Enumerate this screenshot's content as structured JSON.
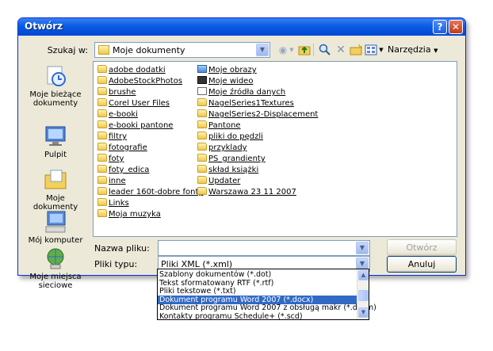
{
  "window": {
    "title": "Otwórz",
    "help_label": "?",
    "close_label": "✕"
  },
  "lookin": {
    "label": "Szukaj w:",
    "value": "Moje dokumenty"
  },
  "toolbar": {
    "tools_label": "Narzędzia"
  },
  "places": [
    {
      "label": "Moje bieżące dokumenty",
      "icon": "recent-documents-icon"
    },
    {
      "label": "Pulpit",
      "icon": "desktop-icon"
    },
    {
      "label": "Moje dokumenty",
      "icon": "my-documents-icon"
    },
    {
      "label": "Mój komputer",
      "icon": "my-computer-icon"
    },
    {
      "label": "Moje miejsca sieciowe",
      "icon": "network-places-icon"
    }
  ],
  "files_col1": [
    {
      "name": "adobe dodatki",
      "type": "folder"
    },
    {
      "name": "AdobeStockPhotos",
      "type": "folder"
    },
    {
      "name": "brushe",
      "type": "folder"
    },
    {
      "name": "Corel User Files",
      "type": "folder"
    },
    {
      "name": "e-booki",
      "type": "folder"
    },
    {
      "name": "e-booki pantone",
      "type": "folder"
    },
    {
      "name": "filtry",
      "type": "folder"
    },
    {
      "name": "fotografie",
      "type": "folder"
    },
    {
      "name": "foty",
      "type": "folder"
    },
    {
      "name": "foty_edica",
      "type": "folder"
    },
    {
      "name": "inne",
      "type": "folder"
    },
    {
      "name": "leader 160t-dobre fonty",
      "type": "folder"
    },
    {
      "name": "Links",
      "type": "folder"
    },
    {
      "name": "Moja muzyka",
      "type": "folder"
    }
  ],
  "files_col2": [
    {
      "name": "Moje obrazy",
      "type": "img"
    },
    {
      "name": "Moje wideo",
      "type": "vid"
    },
    {
      "name": "Moje źródła danych",
      "type": "data"
    },
    {
      "name": "NagelSeries1Textures",
      "type": "folder"
    },
    {
      "name": "NagelSeries2-Displacement",
      "type": "folder"
    },
    {
      "name": "Pantone",
      "type": "folder"
    },
    {
      "name": "pliki do pędzli",
      "type": "folder"
    },
    {
      "name": "przyklady",
      "type": "folder"
    },
    {
      "name": "PS_grandienty",
      "type": "folder"
    },
    {
      "name": "skład książki",
      "type": "folder"
    },
    {
      "name": "Updater",
      "type": "folder"
    },
    {
      "name": "Warszawa 23 11 2007",
      "type": "folder"
    }
  ],
  "filename": {
    "label": "Nazwa pliku:",
    "value": ""
  },
  "filetype": {
    "label": "Pliki typu:",
    "value": "Pliki XML (*.xml)",
    "options": [
      "Szablony dokumentów (*.dot)",
      "Tekst sformatowany RTF (*.rtf)",
      "Pliki tekstowe (*.txt)",
      "Dokument programu Word 2007 (*.docx)",
      "Dokument programu Word 2007 z obsługą makr (*.docm)",
      "Kontakty programu Schedule+ (*.scd)"
    ],
    "selected_index": 3
  },
  "buttons": {
    "open": "Otwórz",
    "cancel": "Anuluj"
  }
}
